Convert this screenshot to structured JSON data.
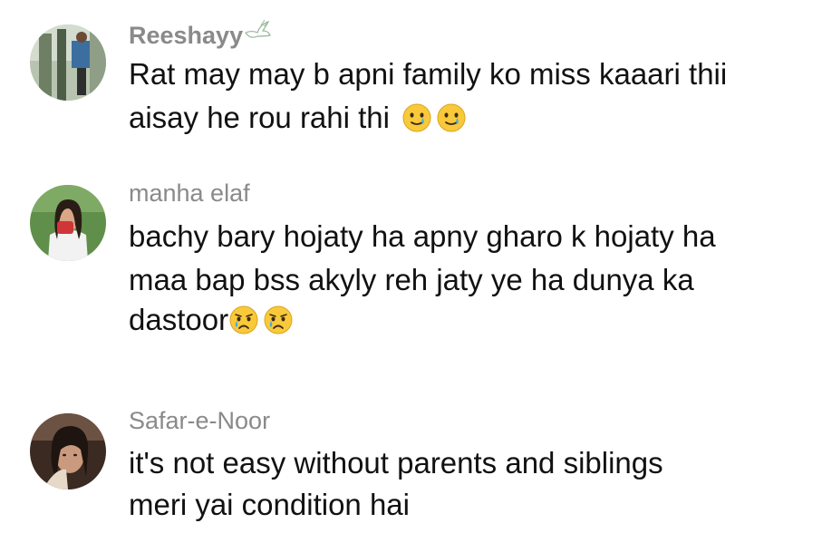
{
  "comments": [
    {
      "username": "Reeshayy",
      "username_icon": "dove-icon",
      "lines": [
        "Rat may may b apni family ko miss kaaari thii",
        "aisay he rou rahi thi"
      ],
      "line_emojis": [
        [],
        [
          "smiling-face-with-tear-icon",
          "smiling-face-with-tear-icon"
        ]
      ]
    },
    {
      "username": "manha elaf",
      "lines": [
        "bachy bary hojaty ha apny gharo k hojaty ha",
        "maa bap bss akyly reh jaty ye ha dunya ka",
        "dastoor"
      ],
      "line_emojis": [
        [],
        [],
        [
          "crying-face-icon",
          "crying-face-icon"
        ]
      ]
    },
    {
      "username": "Safar-e-Noor",
      "lines": [
        "it's not easy without parents and siblings",
        "meri yai condition hai"
      ],
      "line_emojis": [
        [],
        []
      ]
    }
  ],
  "colors": {
    "username": "#8a8a8a",
    "text": "#111111",
    "emoji_face": "#F9C93A",
    "tear": "#4AA8E8"
  }
}
